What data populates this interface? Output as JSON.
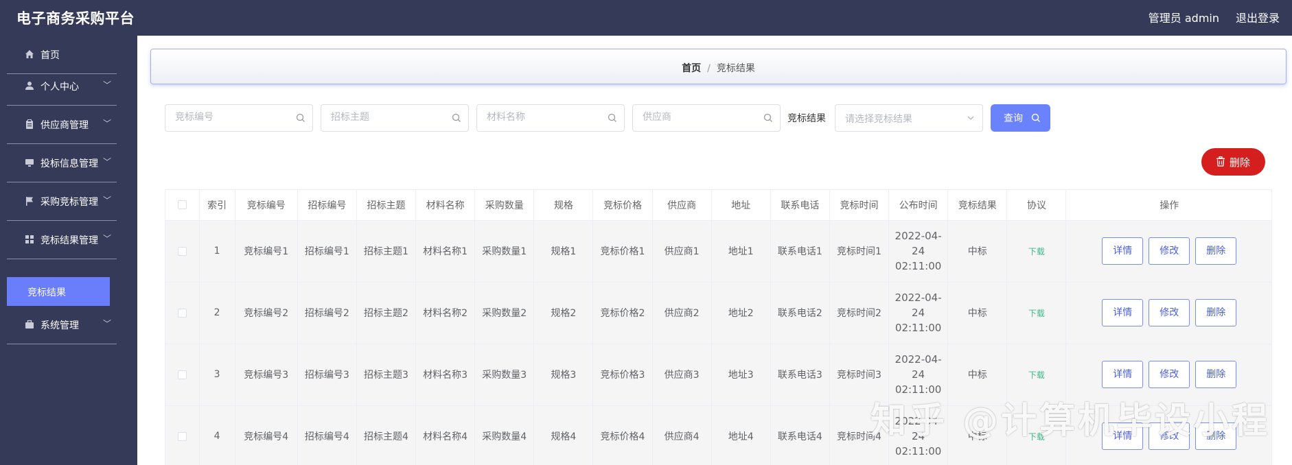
{
  "app": {
    "title": "电子商务采购平台",
    "user_label": "管理员 admin",
    "logout_label": "退出登录"
  },
  "sidebar": {
    "items": [
      {
        "label": "首页",
        "icon": "home-icon",
        "has_arrow": false
      },
      {
        "label": "个人中心",
        "icon": "user-icon",
        "has_arrow": true
      },
      {
        "label": "供应商管理",
        "icon": "clipboard-icon",
        "has_arrow": true
      },
      {
        "label": "投标信息管理",
        "icon": "monitor-icon",
        "has_arrow": true
      },
      {
        "label": "采购竞标管理",
        "icon": "flag-icon",
        "has_arrow": true
      },
      {
        "label": "竞标结果管理",
        "icon": "grid-icon",
        "has_arrow": true
      },
      {
        "label": "系统管理",
        "icon": "briefcase-icon",
        "has_arrow": true
      }
    ],
    "active_sub": "竞标结果"
  },
  "breadcrumb": {
    "home": "首页",
    "separator": "/",
    "current": "竞标结果"
  },
  "search": {
    "bid_no_placeholder": "竞标编号",
    "tender_topic_placeholder": "招标主题",
    "material_placeholder": "材料名称",
    "supplier_placeholder": "供应商",
    "result_label": "竞标结果",
    "result_placeholder": "请选择竞标结果",
    "query_label": "查询"
  },
  "toolbar": {
    "delete_label": "删除"
  },
  "table": {
    "headers": [
      "索引",
      "竞标编号",
      "招标编号",
      "招标主题",
      "材料名称",
      "采购数量",
      "规格",
      "竞标价格",
      "供应商",
      "地址",
      "联系电话",
      "竞标时间",
      "公布时间",
      "竞标结果",
      "协议",
      "操作"
    ],
    "rows": [
      {
        "index": "1",
        "bid_no": "竞标编号1",
        "tender_no": "招标编号1",
        "topic": "招标主题1",
        "material": "材料名称1",
        "qty": "采购数量1",
        "spec": "规格1",
        "price": "竞标价格1",
        "supplier": "供应商1",
        "address": "地址1",
        "phone": "联系电话1",
        "bid_time": "竞标时间1",
        "publish_time": "2022-04-24 02:11:00",
        "result": "中标",
        "agreement": "下载"
      },
      {
        "index": "2",
        "bid_no": "竞标编号2",
        "tender_no": "招标编号2",
        "topic": "招标主题2",
        "material": "材料名称2",
        "qty": "采购数量2",
        "spec": "规格2",
        "price": "竞标价格2",
        "supplier": "供应商2",
        "address": "地址2",
        "phone": "联系电话2",
        "bid_time": "竞标时间2",
        "publish_time": "2022-04-24 02:11:00",
        "result": "中标",
        "agreement": "下载"
      },
      {
        "index": "3",
        "bid_no": "竞标编号3",
        "tender_no": "招标编号3",
        "topic": "招标主题3",
        "material": "材料名称3",
        "qty": "采购数量3",
        "spec": "规格3",
        "price": "竞标价格3",
        "supplier": "供应商3",
        "address": "地址3",
        "phone": "联系电话3",
        "bid_time": "竞标时间3",
        "publish_time": "2022-04-24 02:11:00",
        "result": "中标",
        "agreement": "下载"
      },
      {
        "index": "4",
        "bid_no": "竞标编号4",
        "tender_no": "招标编号4",
        "topic": "招标主题4",
        "material": "材料名称4",
        "qty": "采购数量4",
        "spec": "规格4",
        "price": "竞标价格4",
        "supplier": "供应商4",
        "address": "地址4",
        "phone": "联系电话4",
        "bid_time": "竞标时间4",
        "publish_time": "2022-04-24 02:11:00",
        "result": "中标",
        "agreement": "下载"
      }
    ],
    "actions": {
      "detail": "详情",
      "edit": "修改",
      "delete": "删除"
    }
  },
  "watermark": "知乎 @计算机毕设小程",
  "colors": {
    "nav_bg": "#353a58",
    "accent": "#6a82fb",
    "danger": "#d51f1f",
    "download": "#3db88a"
  }
}
